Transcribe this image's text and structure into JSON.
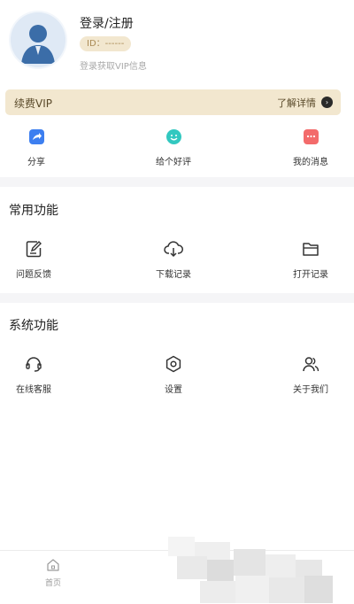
{
  "profile": {
    "login_label": "登录/注册",
    "id_label": "ID：------",
    "vip_hint": "登录获取VIP信息"
  },
  "vip_banner": {
    "title": "续费VIP",
    "more": "了解详情",
    "arrow": "›"
  },
  "quick_actions": [
    {
      "label": "分享",
      "icon": "share-icon",
      "color": "#3d7ff0"
    },
    {
      "label": "给个好评",
      "icon": "smile-icon",
      "color": "#32c8c0"
    },
    {
      "label": "我的消息",
      "icon": "message-icon",
      "color": "#f36b6b"
    }
  ],
  "common": {
    "title": "常用功能",
    "items": [
      {
        "label": "问题反馈",
        "icon": "feedback-icon"
      },
      {
        "label": "下载记录",
        "icon": "cloud-download-icon"
      },
      {
        "label": "打开记录",
        "icon": "folder-icon"
      }
    ]
  },
  "system": {
    "title": "系统功能",
    "items": [
      {
        "label": "在线客服",
        "icon": "headset-icon"
      },
      {
        "label": "设置",
        "icon": "settings-icon"
      },
      {
        "label": "关于我们",
        "icon": "users-icon"
      }
    ]
  },
  "tabbar": {
    "home_label": "首页"
  },
  "colors": {
    "vip_bg": "#f2e7cf",
    "divider": "#f5f5f7"
  }
}
